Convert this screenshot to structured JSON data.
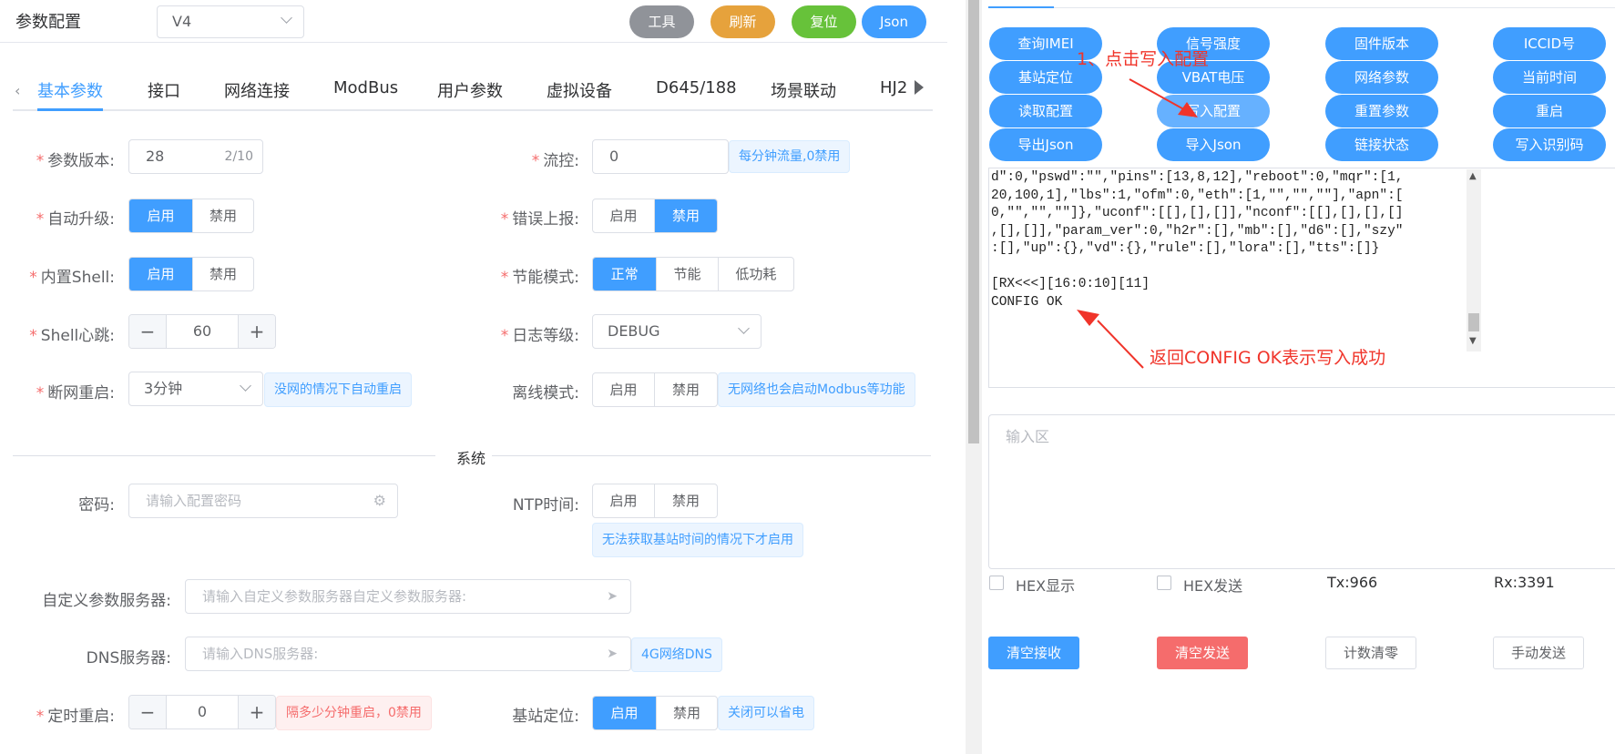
{
  "header": {
    "title": "参数配置",
    "version_select": "V4",
    "buttons": {
      "tools": "工具",
      "refresh": "刷新",
      "reset": "复位",
      "json": "Json"
    }
  },
  "tabs": [
    "基本参数",
    "接口",
    "网络连接",
    "ModBus",
    "用户参数",
    "虚拟设备",
    "D645/188",
    "场景联动",
    "HJ2"
  ],
  "form": {
    "param_version": {
      "label": "参数版本:",
      "value": "28",
      "count": "2/10"
    },
    "flow_control": {
      "label": "流控:",
      "value": "0",
      "hint": "每分钟流量,0禁用"
    },
    "auto_upgrade": {
      "label": "自动升级:",
      "on": "启用",
      "off": "禁用"
    },
    "error_report": {
      "label": "错误上报:",
      "on": "启用",
      "off": "禁用"
    },
    "builtin_shell": {
      "label": "内置Shell:",
      "on": "启用",
      "off": "禁用"
    },
    "power_mode": {
      "label": "节能模式:",
      "options": [
        "正常",
        "节能",
        "低功耗"
      ]
    },
    "shell_heartbeat": {
      "label": "Shell心跳:",
      "value": "60",
      "minus": "−",
      "plus": "+"
    },
    "log_level": {
      "label": "日志等级:",
      "value": "DEBUG"
    },
    "net_reboot": {
      "label": "断网重启:",
      "value": "3分钟",
      "hint": "没网的情况下自动重启"
    },
    "offline_mode": {
      "label": "离线模式:",
      "on": "启用",
      "off": "禁用",
      "hint": "无网络也会启动Modbus等功能"
    },
    "section_system": "系统",
    "password": {
      "label": "密码:",
      "placeholder": "请输入配置密码"
    },
    "ntp": {
      "label": "NTP时间:",
      "on": "启用",
      "off": "禁用",
      "hint": "无法获取基站时间的情况下才启用"
    },
    "custom_server": {
      "label": "自定义参数服务器:",
      "placeholder": "请输入自定义参数服务器自定义参数服务器:"
    },
    "dns": {
      "label": "DNS服务器:",
      "placeholder": "请输入DNS服务器:",
      "hint": "4G网络DNS"
    },
    "timed_reboot": {
      "label": "定时重启:",
      "value": "0",
      "minus": "−",
      "plus": "+",
      "hint": "隔多少分钟重启，0禁用"
    },
    "lbs": {
      "label": "基站定位:",
      "on": "启用",
      "off": "禁用",
      "hint": "关闭可以省电"
    }
  },
  "right": {
    "cmd_buttons": [
      "查询IMEI",
      "信号强度",
      "固件版本",
      "ICCID号",
      "基站定位",
      "VBAT电压",
      "网络参数",
      "当前时间",
      "读取配置",
      "写入配置",
      "重置参数",
      "重启",
      "导出Json",
      "导入Json",
      "链接状态",
      "写入识别码"
    ],
    "terminal_lines": [
      "d\":0,\"pswd\":\"\",\"pins\":[13,8,12],\"reboot\":0,\"mqr\":[1,",
      "20,100,1],\"lbs\":1,\"ofm\":0,\"eth\":[1,\"\",\"\",\"\"],\"apn\":[",
      "0,\"\",\"\",\"\"]},\"uconf\":[[],[],[]],\"nconf\":[[],[],[],[]",
      ",[],[]],\"param_ver\":0,\"h2r\":[],\"mb\":[],\"d6\":[],\"szy\"",
      ":[],\"up\":{},\"vd\":{},\"rule\":[],\"lora\":[],\"tts\":[]}",
      "",
      "[RX<<<][16:0:10][11]",
      "CONFIG OK"
    ],
    "annotation_1": "1、点击写入配置",
    "annotation_2": "返回CONFIG OK表示写入成功",
    "input_placeholder": "输入区",
    "hex_display": "HEX显示",
    "hex_send": "HEX发送",
    "tx": "Tx:966",
    "rx": "Rx:3391",
    "buttons": {
      "clear_rx": "清空接收",
      "clear_tx": "清空发送",
      "reset_count": "计数清零",
      "manual_send": "手动发送"
    }
  },
  "colors": {
    "primary": "#409eff",
    "danger": "#f56c6c",
    "success": "#67c23a",
    "warning": "#e6a23c",
    "info": "#909399",
    "annotation": "#f0342a"
  }
}
